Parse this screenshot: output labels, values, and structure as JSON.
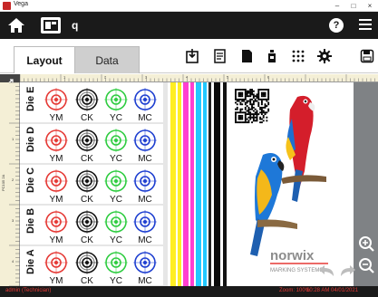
{
  "window": {
    "title": "Vega",
    "minimize": "–",
    "maximize": "□",
    "close": "×"
  },
  "header": {
    "job_name": "q",
    "help": "?"
  },
  "tabs": [
    {
      "label": "Layout"
    },
    {
      "label": "Data"
    }
  ],
  "toolbar_icons": [
    "import-icon",
    "report-icon",
    "print-icon",
    "ink-icon",
    "grid-icon",
    "settings-icon",
    "save-icon"
  ],
  "rows": [
    {
      "label": "Die E",
      "marks": [
        "YM",
        "CK",
        "YC",
        "MC"
      ]
    },
    {
      "label": "Die D",
      "marks": [
        "YM",
        "CK",
        "YC",
        "MC"
      ]
    },
    {
      "label": "Die C",
      "marks": [
        "YM",
        "CK",
        "YC",
        "MC"
      ]
    },
    {
      "label": "Die B",
      "marks": [
        "YM",
        "CK",
        "YC",
        "MC"
      ]
    },
    {
      "label": "Die A",
      "marks": [
        "YM",
        "CK",
        "YC",
        "MC"
      ]
    }
  ],
  "ruler_top_numbers": [
    "1",
    "2",
    "3",
    "4",
    "5",
    "6"
  ],
  "ruler_left_numbers": [
    "1",
    "2",
    "3",
    "4"
  ],
  "ruler_left_label": "PC105 2A",
  "branding": {
    "logo": "norwix",
    "tagline": "MARKING SYSTEMS"
  },
  "status": {
    "user": "admin (Technician)",
    "zoom": "Zoom: 100%",
    "time": "10:28 AM 04/01/2021"
  },
  "colors": {
    "accent_red": "#e53935",
    "header_bg": "#1a1a1a",
    "canvas_bg": "#7f8285",
    "ruler_bg": "#f4efd6"
  }
}
